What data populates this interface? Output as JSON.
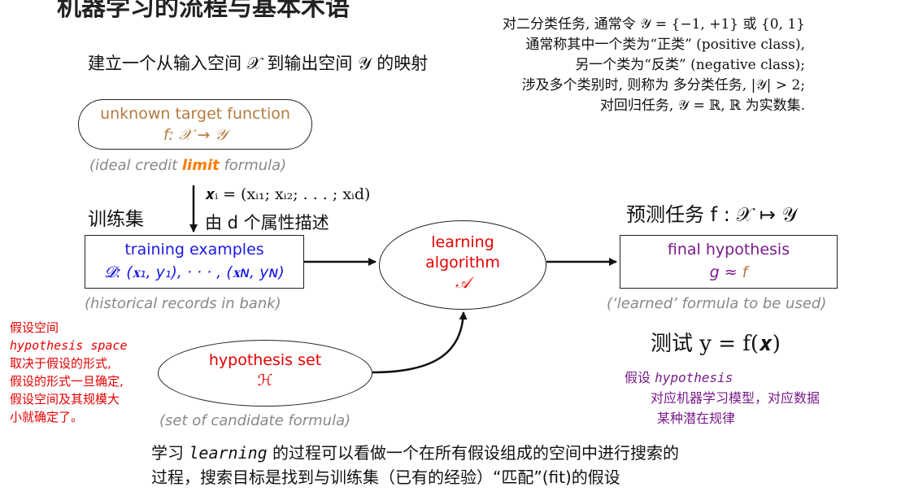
{
  "header": {
    "title_partial": "机器学习的流程与基本术语"
  },
  "notes": {
    "binary": "对二分类任务, 通常令 𝒴 = {−1, +1} 或 {0, 1}",
    "positive": "通常称其中一个类为“正类” (positive class),",
    "negative": "另一个类为“反类” (negative class);",
    "multiclass": "涉及多个类别时, 则称为 多分类任务, |𝒴| > 2;",
    "regression": "对回归任务, 𝒴 = ℝ, ℝ 为实数集."
  },
  "mapping": "建立一个从输入空间 𝒳 到输出空间 𝒴 的映射",
  "unknown_target": {
    "title": "unknown target function",
    "formula": "f: 𝒳 → 𝒴",
    "note_pre": "(ideal credit ",
    "note_em": "limit",
    "note_post": " formula)"
  },
  "xi_formula": "𝒙ᵢ = (xᵢ₁; xᵢ₂; . . . ; xᵢd)",
  "attr_text": "由 d 个属性描述",
  "train_label": "训练集",
  "training": {
    "title": "training examples",
    "formula": "𝓓: (𝐱₁, y₁), · · · , (𝐱ɴ, yɴ)",
    "note": "(historical records in bank)"
  },
  "learning": {
    "line1": "learning",
    "line2": "algorithm",
    "line3": "𝒜"
  },
  "predict_text": "预测任务  f : 𝒳 ↦ 𝒴",
  "final": {
    "title": "final hypothesis",
    "g": "g",
    "approx": " ≈ ",
    "f": "f",
    "note": "(‘learned’ formula to be used)"
  },
  "test_text": "测试  y = f(𝒙)",
  "hypothesis_set": {
    "title": "hypothesis set",
    "symbol": "ℋ",
    "note": "(set of candidate formula)"
  },
  "red_note": {
    "l1": "假设空间",
    "l2": "hypothesis space",
    "l3": "取决于假设的形式,",
    "l4": "假设的形式一旦确定,",
    "l5": "假设空间及其规模大",
    "l6": "小就确定了。"
  },
  "purple_note": {
    "l1a": "假设 ",
    "l1b": "hypothesis",
    "l2": "对应机器学习模型，对应数据",
    "l3": "某种潜在规律"
  },
  "bottom": {
    "l1a": "学习 ",
    "l1b": "learning",
    "l1c": " 的过程可以看做一个在所有假设组成的空间中进行搜索的",
    "l2": "过程，搜索目标是找到与训练集（已有的经验）“匹配”(fit)的假设"
  },
  "colors": {
    "red": "#e60000",
    "blue": "#1a1ae6",
    "purple": "#7a1a8a",
    "brown": "#b47a3e",
    "orange": "#ff7a00",
    "gray": "#888888"
  }
}
